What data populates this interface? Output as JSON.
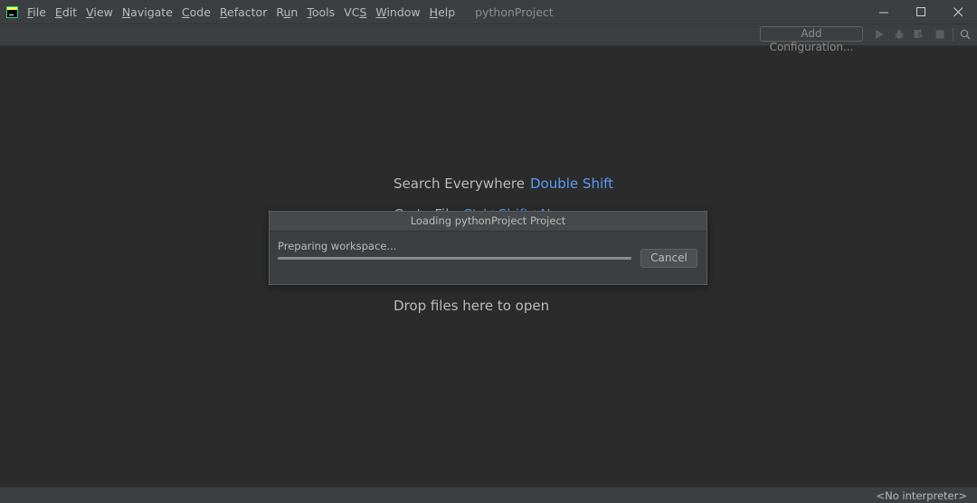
{
  "menu": {
    "items": [
      {
        "mnemonic": "F",
        "rest": "ile"
      },
      {
        "mnemonic": "E",
        "rest": "dit"
      },
      {
        "mnemonic": "V",
        "rest": "iew"
      },
      {
        "mnemonic": "N",
        "rest": "avigate"
      },
      {
        "mnemonic": "C",
        "rest": "ode"
      },
      {
        "mnemonic": "R",
        "rest": "efactor"
      },
      {
        "pre": "R",
        "mnemonic": "u",
        "rest": "n"
      },
      {
        "mnemonic": "T",
        "rest": "ools"
      },
      {
        "pre": "VC",
        "mnemonic": "S",
        "rest": ""
      },
      {
        "mnemonic": "W",
        "rest": "indow"
      },
      {
        "mnemonic": "H",
        "rest": "elp"
      }
    ]
  },
  "window": {
    "project_name": "pythonProject"
  },
  "toolbar": {
    "add_config_label": "Add Configuration..."
  },
  "hints": {
    "search_label": "Search Everywhere",
    "search_shortcut": "Double Shift",
    "goto_label": "Go to File",
    "goto_shortcut": "Ctrl+Shift+N",
    "drop_label": "Drop files here to open"
  },
  "dialog": {
    "title": "Loading pythonProject Project",
    "status": "Preparing workspace...",
    "progress": 1.0,
    "cancel_label": "Cancel"
  },
  "statusbar": {
    "interpreter": "<No interpreter>"
  },
  "colors": {
    "shortcut": "#589df6",
    "background": "#2b2b2b",
    "panel": "#3c3f41"
  }
}
